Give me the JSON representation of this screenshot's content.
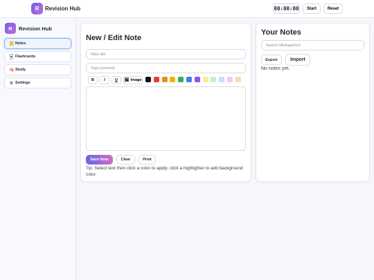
{
  "topbar": {
    "logo_letter": "R",
    "title": "Revision Hub",
    "timer": "00:00:00",
    "start_label": "Start",
    "reset_label": "Reset"
  },
  "sidebar": {
    "logo_letter": "R",
    "title": "Revision Hub",
    "items": [
      {
        "icon": "notepad-icon",
        "glyph": "📒",
        "label": "Notes",
        "active": true
      },
      {
        "icon": "flashcard-icon",
        "glyph": "🃏",
        "label": "Flashcards",
        "active": false
      },
      {
        "icon": "brain-icon",
        "glyph": "🧠",
        "label": "Study",
        "active": false
      },
      {
        "icon": "gear-icon",
        "glyph": "⚙",
        "label": "Settings",
        "active": false
      }
    ]
  },
  "editor": {
    "title": "New / Edit Note",
    "title_placeholder": "Note title",
    "tags_placeholder": "Tags (comma)",
    "toolbar": {
      "bold": "B",
      "italic": "I",
      "underline": "U",
      "image_icon": "image-icon",
      "image_glyph": "🖼",
      "image_label": "Image"
    },
    "text_colors": [
      "#111111",
      "#e03e3e",
      "#f08c1a",
      "#e6b800",
      "#2fb35c",
      "#3b82e6",
      "#8e55e8"
    ],
    "highlight_colors": [
      "#fbeaa0",
      "#c7efc9",
      "#bfe3f3",
      "#f5c9e6",
      "#f8d9b5"
    ],
    "save_label": "Save Note",
    "clear_label": "Clear",
    "print_label": "Print",
    "tip": "Tip: Select text then click a color to apply; click a highlighter to add background color."
  },
  "notes": {
    "title": "Your Notes",
    "search_placeholder": "Search title/tags/text",
    "export_label": "Export",
    "import_label": "Import",
    "empty_text": "No notes yet."
  },
  "colors": {
    "accent_start": "#6c63e6",
    "accent_end": "#d36cc6"
  }
}
